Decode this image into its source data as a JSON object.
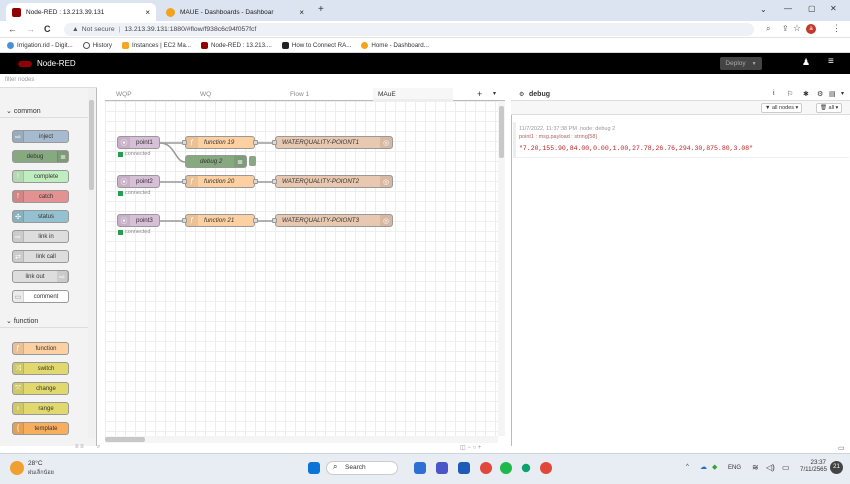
{
  "browser": {
    "tabs": [
      {
        "title": "Node-RED : 13.213.39.131",
        "close": "×"
      },
      {
        "title": "MAUE - Dashboards - Dashboar",
        "close": "×"
      }
    ],
    "new_tab": "+",
    "window_controls": [
      "⌄",
      "—",
      "▢",
      "✕"
    ],
    "nav": {
      "back": "←",
      "forward": "→",
      "reload": "C"
    },
    "security_label": "Not secure",
    "url": "13.213.39.131:1880/#flow/f938c6c94f057fcf",
    "bookmarks": [
      "Irrigation.rid - Digit...",
      "History",
      "Instances | EC2 Ma...",
      "Node-RED : 13.213....",
      "How to Connect RA...",
      "Home - Dashboard..."
    ],
    "profile_initial": "a"
  },
  "nodered": {
    "app_title": "Node-RED",
    "deploy_label": "Deploy",
    "palette": {
      "filter_placeholder": "filter nodes",
      "categories": [
        {
          "label": "common",
          "nodes": [
            "inject",
            "debug",
            "complete",
            "catch",
            "status",
            "link in",
            "link call",
            "link out",
            "comment"
          ]
        },
        {
          "label": "function",
          "nodes": [
            "function",
            "switch",
            "change",
            "range",
            "template"
          ]
        }
      ]
    },
    "workspace_tabs": [
      "WQP",
      "WQ",
      "Flow 1",
      "MAuE"
    ],
    "workspace_add": "+",
    "flow_nodes": {
      "point1": "point1",
      "point2": "point2",
      "point3": "point3",
      "function19": "function 19",
      "function20": "function 20",
      "function21": "function 21",
      "debug2": "debug 2",
      "wq1": "WATERQUALITY-POIONT1",
      "wq2": "WATERQUALITY-POIONT2",
      "wq3": "WATERQUALITY-POIONT3",
      "connected": "connected"
    },
    "sidebar": {
      "tab_label": "debug",
      "filter_all_nodes": "all nodes",
      "filter_all": "all",
      "message": {
        "timestamp": "11/7/2022, 11:37:38 PM",
        "node": "node: debug 2",
        "topic": "point1 : msg.payload : string[58]",
        "payload": "\"7.20,155.90,84.00,0.00,1.00,27.78,26.76,294.30,875.80,3.08\""
      }
    }
  },
  "taskbar": {
    "weather_temp": "28°C",
    "weather_desc": "ฝนเล็กน้อย",
    "search_label": "Search",
    "lang": "ENG",
    "time": "23:37",
    "date": "7/11/2565",
    "notification_count": "21"
  },
  "colors": {
    "inject": "#a6bbcf",
    "debug": "#87a980",
    "complete": "#c0edc0",
    "catch": "#e49191",
    "status": "#94c1d0",
    "link": "#dddddd",
    "function": "#fdd0a2",
    "switch": "#e2d96e",
    "change": "#e2d96e",
    "range": "#e2d96e",
    "template": "#f9ae5c",
    "mqtt": "#d8bfd8",
    "websocket": "#e8c8b0"
  }
}
